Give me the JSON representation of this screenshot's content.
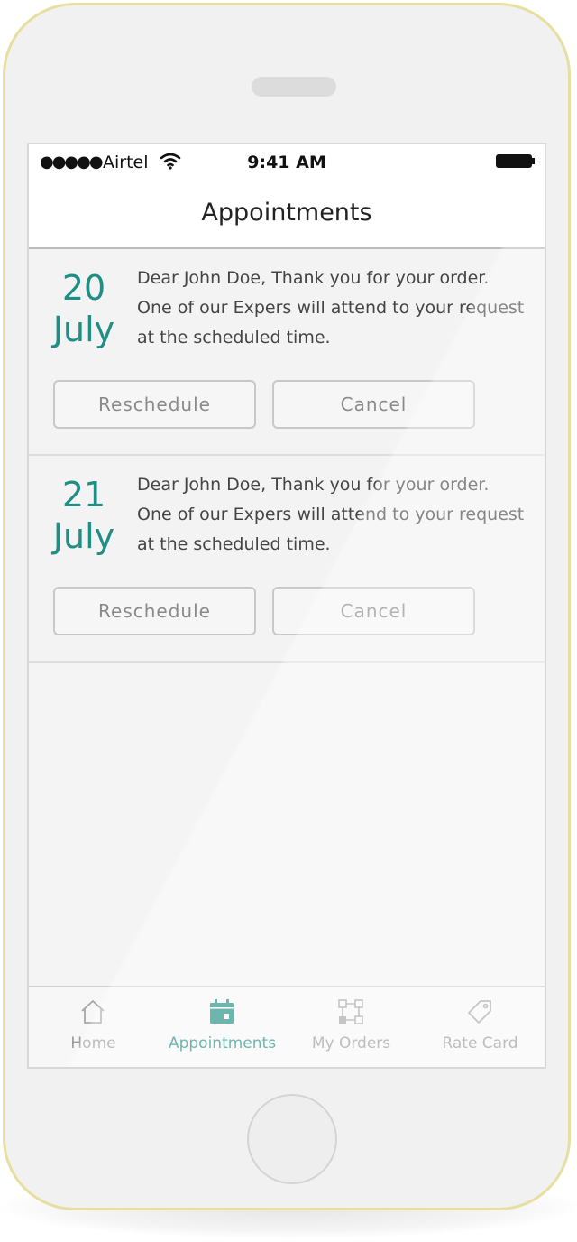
{
  "status_bar": {
    "signal": "●●●●●",
    "carrier": "Airtel",
    "time": "9:41 AM"
  },
  "nav": {
    "title": "Appointments"
  },
  "appointments": [
    {
      "day": "20",
      "month": "July",
      "message": "Dear John Doe, Thank you for your order. One of our Expers will attend to your request at the scheduled time.",
      "reschedule_label": "Reschedule",
      "cancel_label": "Cancel"
    },
    {
      "day": "21",
      "month": "July",
      "message": "Dear John Doe, Thank you for your order. One of our Expers will attend to your request at the scheduled time.",
      "reschedule_label": "Reschedule",
      "cancel_label": "Cancel"
    }
  ],
  "tabs": [
    {
      "label": "Home",
      "icon": "home-icon",
      "active": false
    },
    {
      "label": "Appointments",
      "icon": "calendar-icon",
      "active": true
    },
    {
      "label": "My Orders",
      "icon": "orders-icon",
      "active": false
    },
    {
      "label": "Rate Card",
      "icon": "tag-icon",
      "active": false
    }
  ],
  "colors": {
    "accent": "#1f8f86",
    "phone_frame": "#e8dea0"
  }
}
